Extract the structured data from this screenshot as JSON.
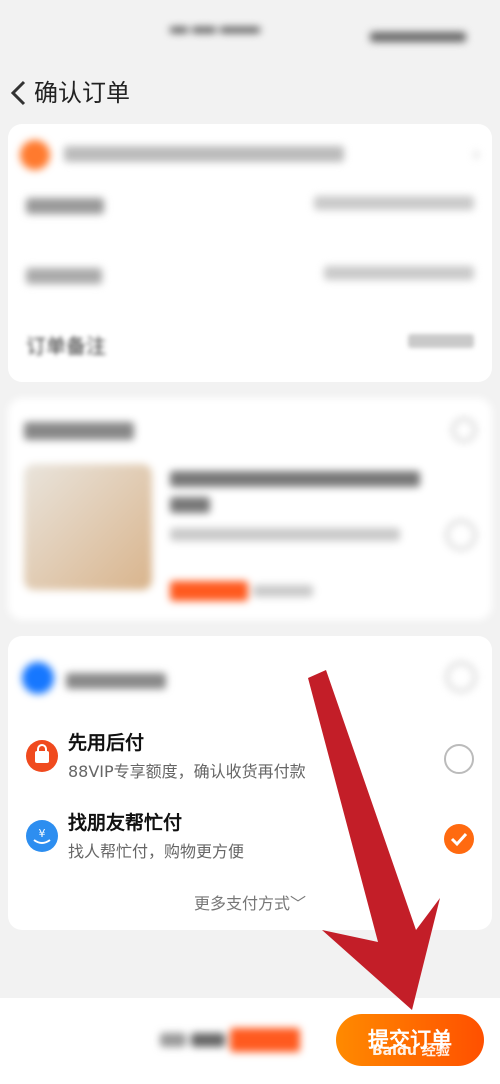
{
  "header": {
    "back_icon": "chevron-left-icon",
    "title": "确认订单"
  },
  "order_info": {
    "remark_label": "订单备注"
  },
  "payment": {
    "options": [
      {
        "title": "先用后付",
        "subtitle": "88VIP专享额度，确认收货再付款",
        "selected": false,
        "icon": "bag-icon",
        "icon_color": "#f04a1e"
      },
      {
        "title": "找朋友帮忙付",
        "subtitle": "找人帮忙付，购物更方便",
        "selected": true,
        "icon": "hand-yuan-icon",
        "icon_color": "#2d8ef0"
      }
    ],
    "more_label": "更多支付方式﹀"
  },
  "bottom_bar": {
    "submit_label": "提交订单"
  },
  "watermark": "Baidu 经验",
  "colors": {
    "accent": "#ff6a10",
    "arrow": "#c0121c"
  }
}
